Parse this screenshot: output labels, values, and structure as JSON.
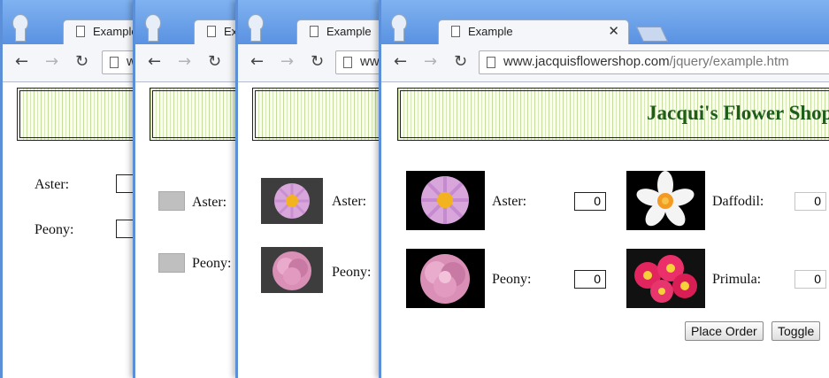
{
  "browser": {
    "tab_title": "Example",
    "url_host": "www.jacquisflowershop.com",
    "url_path": "/jquery/example.htm",
    "url_short": "ww"
  },
  "page": {
    "shop_title": "Jacqui's Flower Shop",
    "flowers": [
      {
        "name": "Aster:",
        "quantity": "0"
      },
      {
        "name": "Peony:",
        "quantity": "0"
      },
      {
        "name": "Daffodil:",
        "quantity": "0"
      },
      {
        "name": "Primula:",
        "quantity": "0"
      }
    ],
    "place_order_label": "Place Order",
    "toggle_label": "Toggle"
  },
  "colors": {
    "frame_blue": "#5b8fd8",
    "title_green": "#1e5c19"
  }
}
